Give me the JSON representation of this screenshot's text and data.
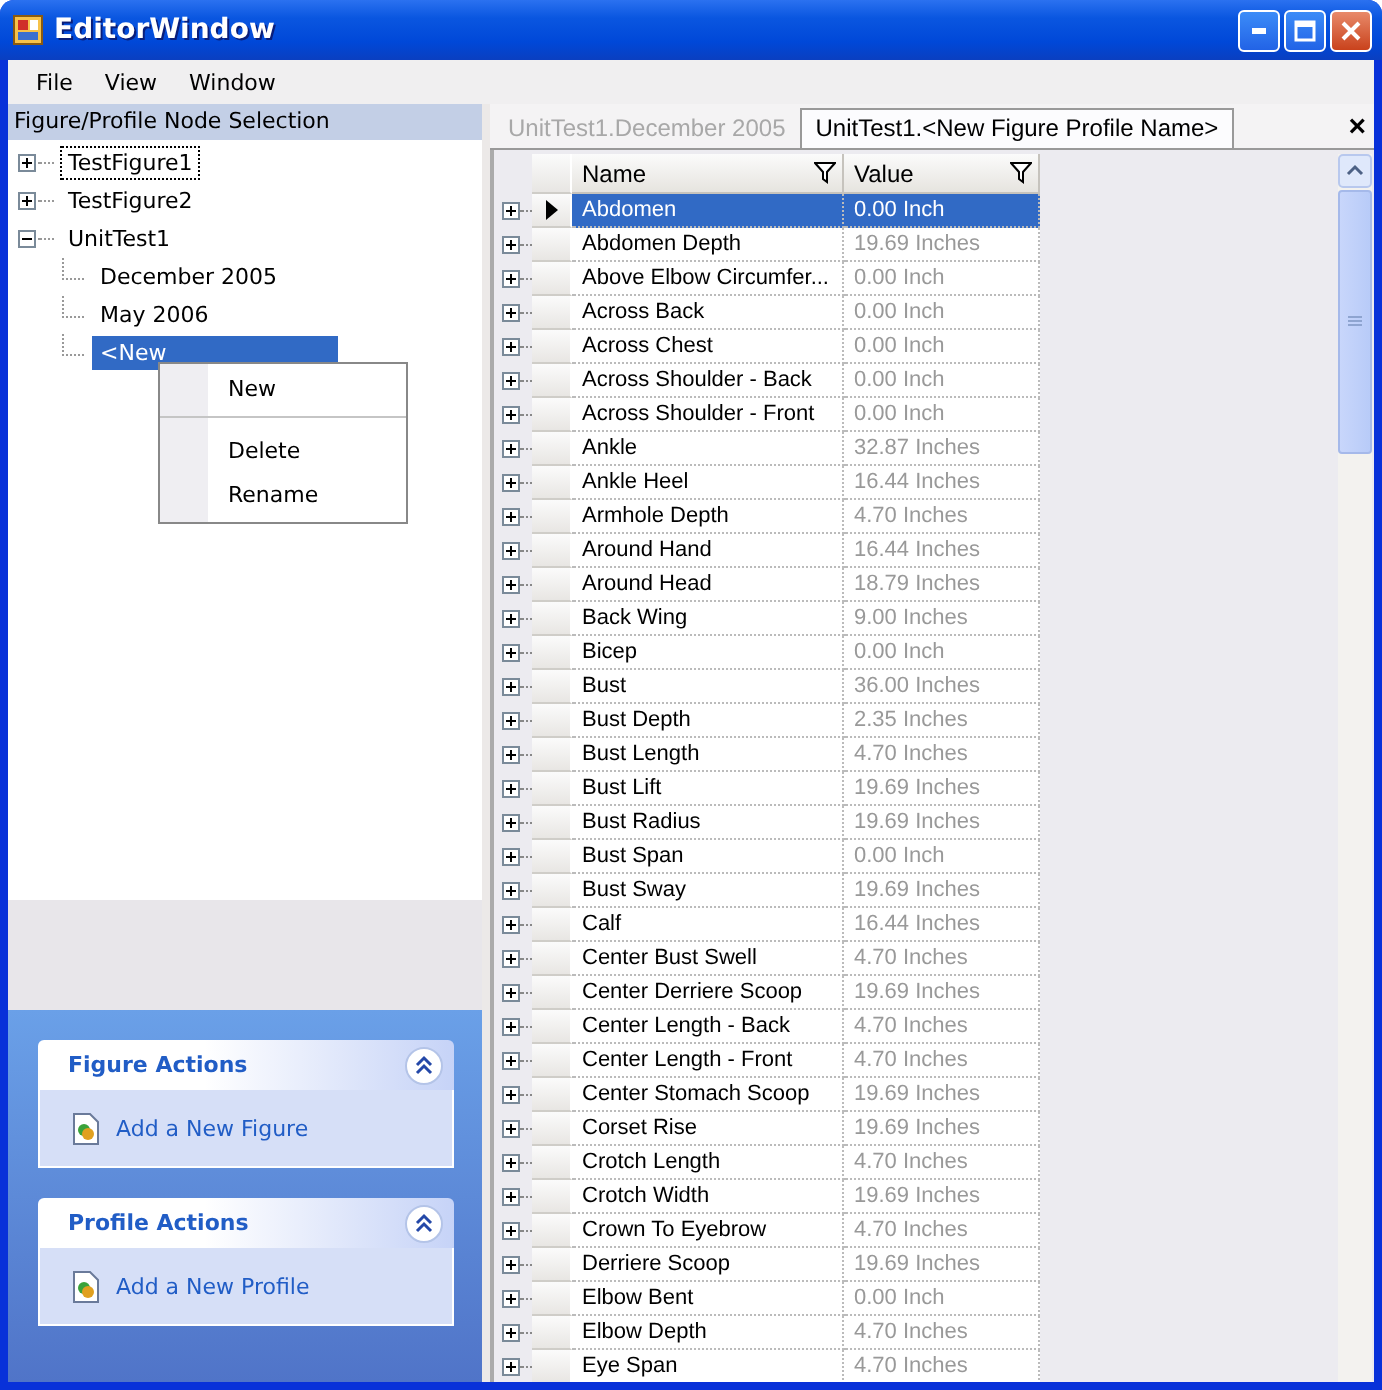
{
  "window": {
    "title": "EditorWindow"
  },
  "menu": [
    "File",
    "View",
    "Window"
  ],
  "tree": {
    "header": "Figure/Profile Node Selection",
    "nodes": [
      {
        "label": "TestFigure1",
        "expanded": false,
        "selected": false,
        "focused": true
      },
      {
        "label": "TestFigure2",
        "expanded": false,
        "selected": false,
        "focused": false
      },
      {
        "label": "UnitTest1",
        "expanded": true,
        "selected": false,
        "focused": false,
        "children": [
          {
            "label": "December 2005",
            "selected": false,
            "focused": false
          },
          {
            "label": "May 2006",
            "selected": false,
            "focused": false
          },
          {
            "label": "<New",
            "selected": true,
            "focused": false
          }
        ]
      }
    ]
  },
  "context_menu": [
    {
      "label": "New",
      "separator_after": true
    },
    {
      "label": "Delete",
      "separator_after": false
    },
    {
      "label": "Rename",
      "separator_after": false
    }
  ],
  "task_panels": [
    {
      "title": "Figure Actions",
      "expanded": true,
      "links": [
        "Add a New Figure"
      ]
    },
    {
      "title": "Profile Actions",
      "expanded": true,
      "links": [
        "Add a New Profile"
      ]
    }
  ],
  "tabs": [
    {
      "label": "UnitTest1.December 2005",
      "selected": false
    },
    {
      "label": "UnitTest1.<New Figure Profile Name>",
      "selected": true
    }
  ],
  "close_label": "×",
  "grid": {
    "columns": [
      {
        "label": "Name",
        "filter": true
      },
      {
        "label": "Value",
        "filter": true
      }
    ],
    "rows": [
      {
        "name": "Abdomen",
        "value": "0.00 Inch",
        "selected": true,
        "expanded": false
      },
      {
        "name": "Abdomen Depth",
        "value": "19.69 Inches",
        "selected": false,
        "expanded": false
      },
      {
        "name": "Above Elbow Circumfer...",
        "value": "0.00 Inch",
        "selected": false,
        "expanded": false
      },
      {
        "name": "Across Back",
        "value": "0.00 Inch",
        "selected": false,
        "expanded": false
      },
      {
        "name": "Across Chest",
        "value": "0.00 Inch",
        "selected": false,
        "expanded": false
      },
      {
        "name": "Across Shoulder - Back",
        "value": "0.00 Inch",
        "selected": false,
        "expanded": false
      },
      {
        "name": "Across Shoulder - Front",
        "value": "0.00 Inch",
        "selected": false,
        "expanded": false
      },
      {
        "name": "Ankle",
        "value": "32.87 Inches",
        "selected": false,
        "expanded": false
      },
      {
        "name": "Ankle Heel",
        "value": "16.44 Inches",
        "selected": false,
        "expanded": false
      },
      {
        "name": "Armhole Depth",
        "value": "4.70 Inches",
        "selected": false,
        "expanded": false
      },
      {
        "name": "Around Hand",
        "value": "16.44 Inches",
        "selected": false,
        "expanded": false
      },
      {
        "name": "Around Head",
        "value": "18.79 Inches",
        "selected": false,
        "expanded": false
      },
      {
        "name": "Back Wing",
        "value": "9.00 Inches",
        "selected": false,
        "expanded": false
      },
      {
        "name": "Bicep",
        "value": "0.00 Inch",
        "selected": false,
        "expanded": false
      },
      {
        "name": "Bust",
        "value": "36.00 Inches",
        "selected": false,
        "expanded": false
      },
      {
        "name": "Bust Depth",
        "value": "2.35 Inches",
        "selected": false,
        "expanded": false
      },
      {
        "name": "Bust Length",
        "value": "4.70 Inches",
        "selected": false,
        "expanded": false
      },
      {
        "name": "Bust Lift",
        "value": "19.69 Inches",
        "selected": false,
        "expanded": false
      },
      {
        "name": "Bust Radius",
        "value": "19.69 Inches",
        "selected": false,
        "expanded": false
      },
      {
        "name": "Bust Span",
        "value": "0.00 Inch",
        "selected": false,
        "expanded": false
      },
      {
        "name": "Bust Sway",
        "value": "19.69 Inches",
        "selected": false,
        "expanded": false
      },
      {
        "name": "Calf",
        "value": "16.44 Inches",
        "selected": false,
        "expanded": false
      },
      {
        "name": "Center Bust Swell",
        "value": "4.70 Inches",
        "selected": false,
        "expanded": false
      },
      {
        "name": "Center Derriere Scoop",
        "value": "19.69 Inches",
        "selected": false,
        "expanded": false
      },
      {
        "name": "Center Length - Back",
        "value": "4.70 Inches",
        "selected": false,
        "expanded": false
      },
      {
        "name": "Center Length - Front",
        "value": "4.70 Inches",
        "selected": false,
        "expanded": false
      },
      {
        "name": "Center Stomach Scoop",
        "value": "19.69 Inches",
        "selected": false,
        "expanded": false
      },
      {
        "name": "Corset Rise",
        "value": "19.69 Inches",
        "selected": false,
        "expanded": false
      },
      {
        "name": "Crotch Length",
        "value": "4.70 Inches",
        "selected": false,
        "expanded": false
      },
      {
        "name": "Crotch Width",
        "value": "19.69 Inches",
        "selected": false,
        "expanded": false
      },
      {
        "name": "Crown To Eyebrow",
        "value": "4.70 Inches",
        "selected": false,
        "expanded": false
      },
      {
        "name": "Derriere Scoop",
        "value": "19.69 Inches",
        "selected": false,
        "expanded": false
      },
      {
        "name": "Elbow Bent",
        "value": "0.00 Inch",
        "selected": false,
        "expanded": false
      },
      {
        "name": "Elbow Depth",
        "value": "4.70 Inches",
        "selected": false,
        "expanded": false
      },
      {
        "name": "Eye Span",
        "value": "4.70 Inches",
        "selected": false,
        "expanded": false
      }
    ]
  }
}
